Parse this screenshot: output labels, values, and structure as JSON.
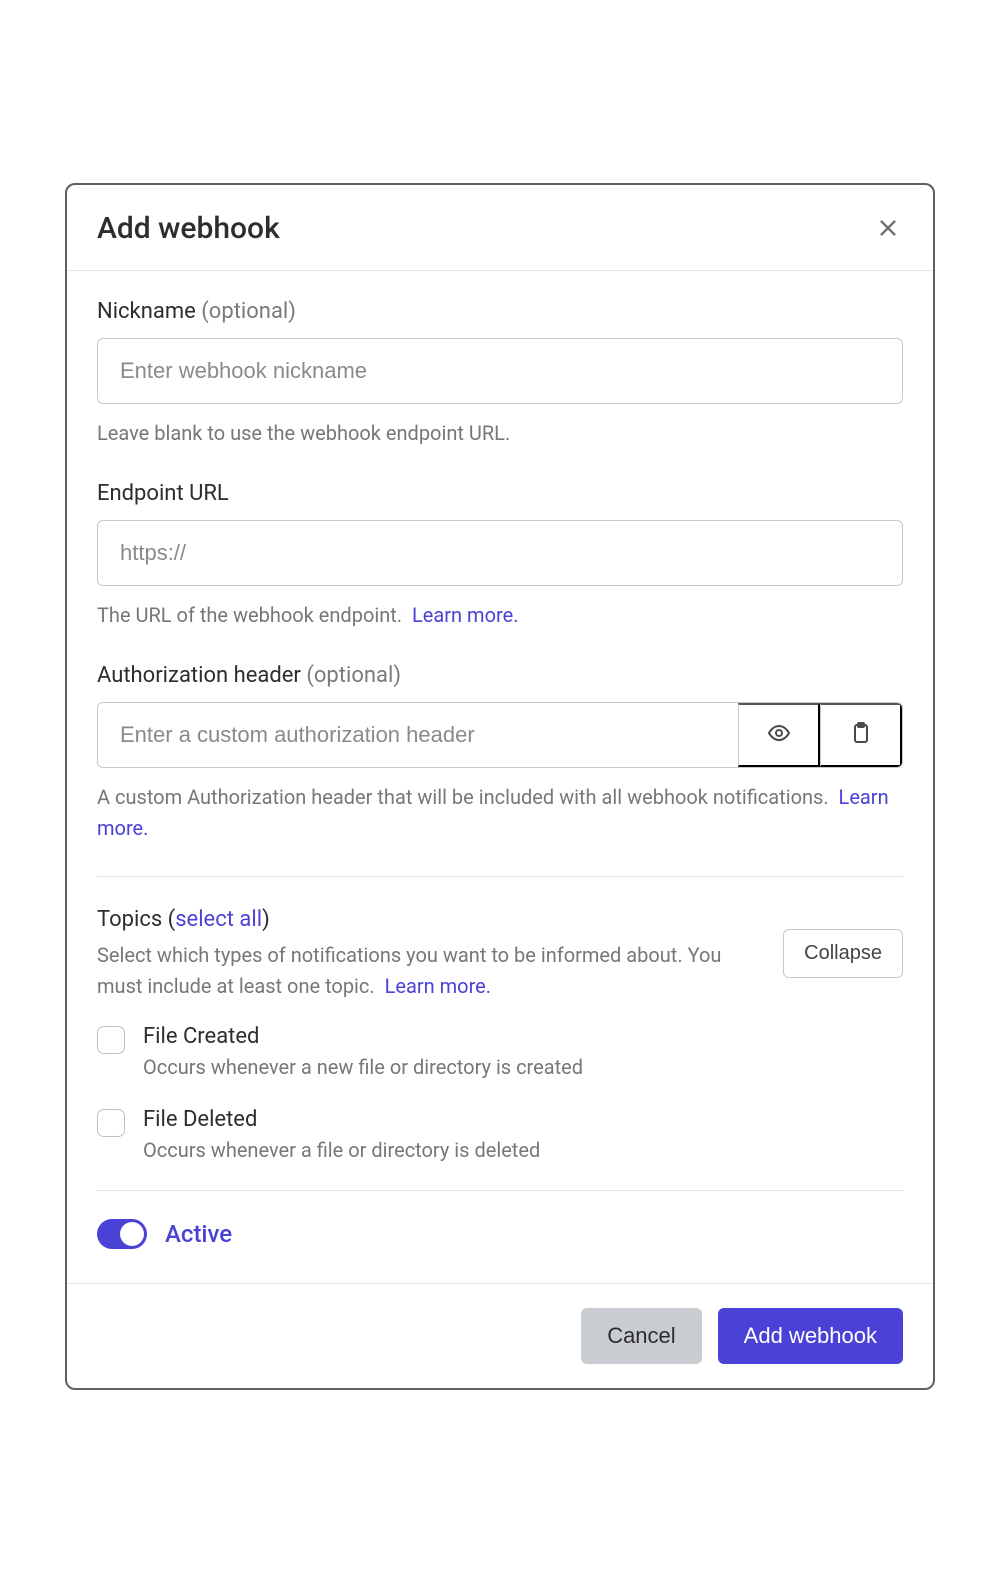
{
  "header": {
    "title": "Add webhook"
  },
  "nickname": {
    "label": "Nickname",
    "optional": "(optional)",
    "placeholder": "Enter webhook nickname",
    "helper": "Leave blank to use the webhook endpoint URL."
  },
  "endpoint": {
    "label": "Endpoint URL",
    "placeholder": "https://",
    "helper": "The URL of the webhook endpoint.",
    "learn_more": "Learn more"
  },
  "auth": {
    "label": "Authorization header",
    "optional": "(optional)",
    "placeholder": "Enter a custom authorization header",
    "helper": "A custom Authorization header that will be included with all webhook notifications.",
    "learn_more": "Learn more"
  },
  "topics": {
    "label": "Topics",
    "select_all": "select all",
    "helper": "Select which types of notifications you want to be informed about. You must include at least one topic.",
    "learn_more": "Learn more",
    "collapse": "Collapse",
    "items": [
      {
        "name": "File Created",
        "desc": "Occurs whenever a new file or directory is created"
      },
      {
        "name": "File Deleted",
        "desc": "Occurs whenever a file or directory is deleted"
      }
    ]
  },
  "active": {
    "label": "Active",
    "value": true
  },
  "footer": {
    "cancel": "Cancel",
    "submit": "Add webhook"
  }
}
